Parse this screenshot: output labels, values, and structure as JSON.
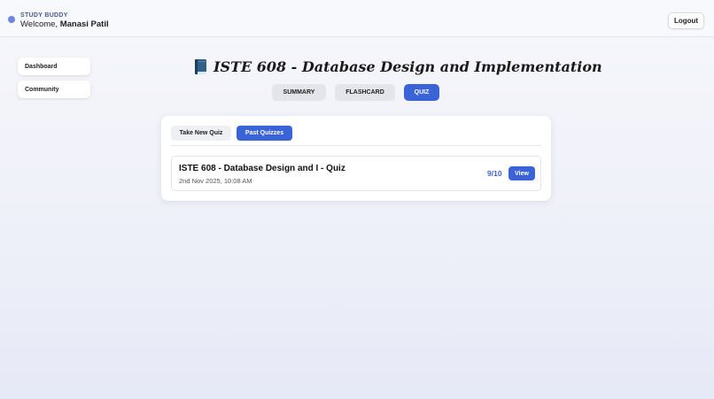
{
  "header": {
    "brand": "STUDY BUDDY",
    "welcome_prefix": "Welcome,",
    "user_name": "Manasi Patil",
    "logout_label": "Logout"
  },
  "sidebar": {
    "items": [
      {
        "label": "Dashboard"
      },
      {
        "label": "Community"
      }
    ]
  },
  "main": {
    "title": "ISTE 608 - Database Design and Implementation",
    "tabs": [
      {
        "label": "SUMMARY",
        "active": false
      },
      {
        "label": "FLASHCARD",
        "active": false
      },
      {
        "label": "QUIZ",
        "active": true
      }
    ]
  },
  "quiz_panel": {
    "subtabs": [
      {
        "label": "Take New Quiz",
        "active": false
      },
      {
        "label": "Past Quizzes",
        "active": true
      }
    ],
    "past_quizzes": [
      {
        "name": "ISTE 608 - Database Design and I - Quiz",
        "date": "2nd Nov 2025, 10:08 AM",
        "score": "9/10",
        "action_label": "View"
      }
    ]
  },
  "colors": {
    "accent": "#3a63d8",
    "brand_dot": "#6f86e6",
    "inactive_tab": "#e4e5ea"
  },
  "icons": {
    "brand": "brand-dot-icon",
    "title": "book-icon"
  }
}
